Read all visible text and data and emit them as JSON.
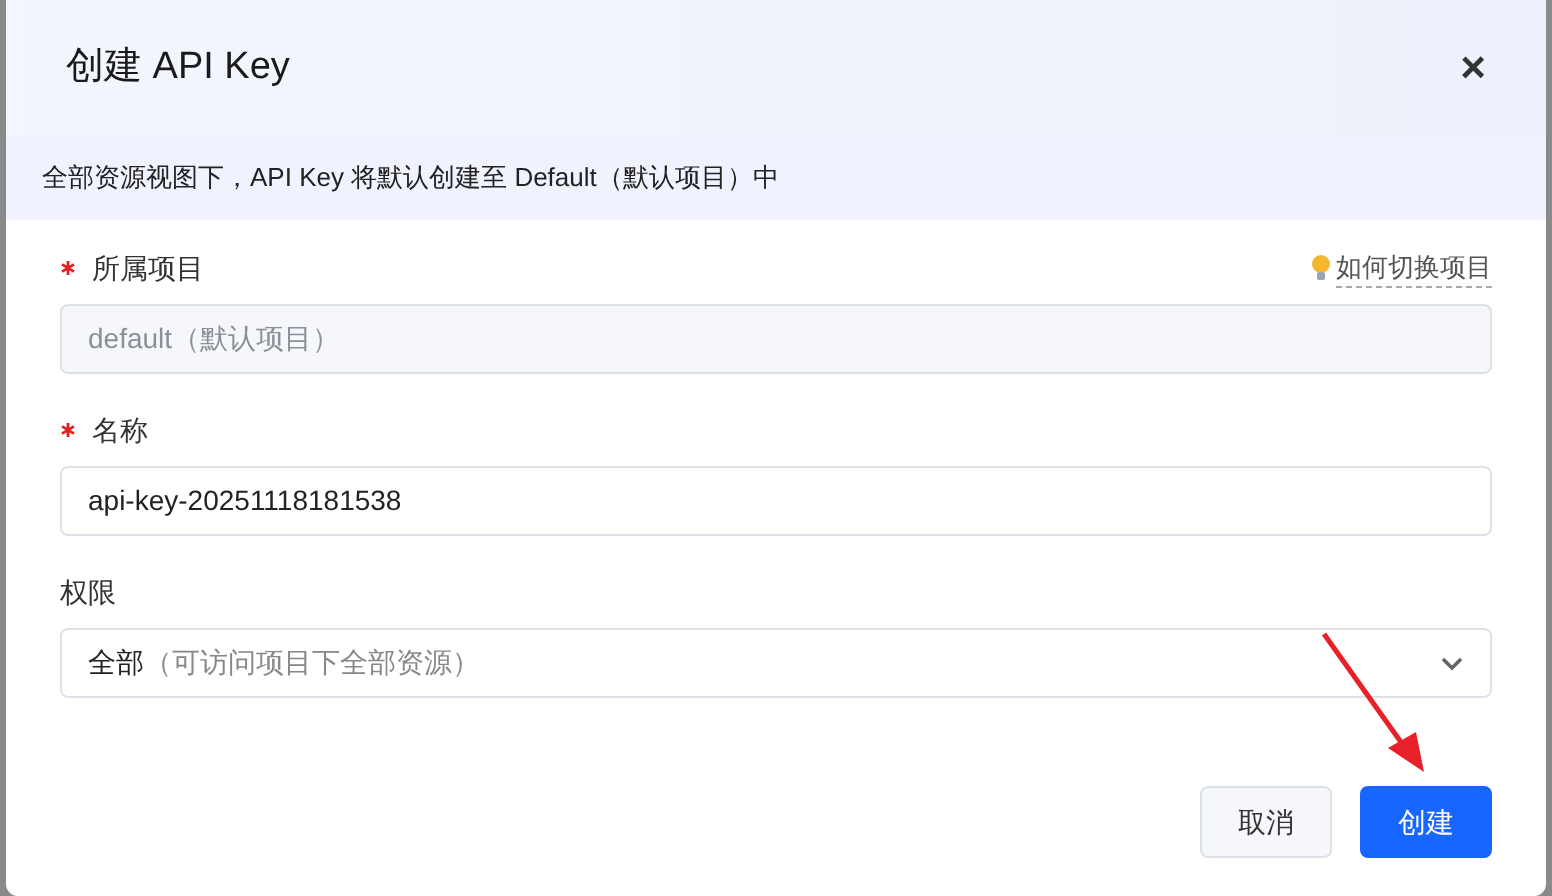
{
  "dialog": {
    "title": "创建 API Key",
    "close": "×"
  },
  "notice": "全部资源视图下，API Key 将默认创建至 Default（默认项目）中",
  "fields": [
    {
      "kind": "input",
      "label": "所属项目",
      "required": true,
      "disabled": true,
      "value": "default（默认项目）",
      "help_link": "如何切换项目"
    },
    {
      "kind": "input",
      "label": "名称",
      "required": true,
      "disabled": false,
      "value": "api-key-20251118181538"
    },
    {
      "kind": "select",
      "label": "权限",
      "required": false,
      "disabled": false,
      "value": "全部",
      "hint": "（可访问项目下全部资源）"
    }
  ],
  "buttons": [
    {
      "label": "取消",
      "kind": "secondary"
    },
    {
      "label": "创建",
      "kind": "primary"
    }
  ]
}
